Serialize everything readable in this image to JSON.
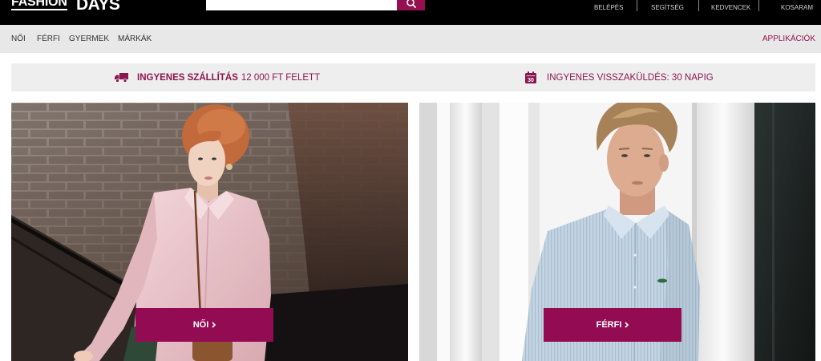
{
  "header": {
    "logo": {
      "line1": "FASHION",
      "line2": "DAYS"
    },
    "search": {
      "icon": "search-icon"
    },
    "user_links": [
      {
        "label": "BELÉPÉS"
      },
      {
        "label": "SEGÍTSÉG"
      },
      {
        "label": "KEDVENCEK"
      },
      {
        "label": "KOSARAM"
      }
    ]
  },
  "nav": {
    "items": [
      {
        "label": "NŐI"
      },
      {
        "label": "FÉRFI"
      },
      {
        "label": "GYERMEK"
      },
      {
        "label": "MÁRKÁK"
      }
    ],
    "apps_label": "APPLIKÁCIÓK"
  },
  "benefits": {
    "shipping": {
      "icon": "truck-icon",
      "title": "INGYENES SZÁLLÍTÁS",
      "detail": "12 000 FT FELETT"
    },
    "returns": {
      "icon": "calendar-icon",
      "calendar_day": "30",
      "text": "INGYENES VISSZAKÜLDÉS: 30 NAPIG"
    }
  },
  "hero": {
    "women": {
      "button_label": "NŐI",
      "button_icon": "chevron-right-icon"
    },
    "men": {
      "button_label": "FÉRFI",
      "button_icon": "chevron-right-icon"
    }
  },
  "colors": {
    "brand": "#930b53",
    "header_bg": "#000000",
    "nav_bg": "#e8e8e8",
    "benefits_bg": "#eeeeee"
  }
}
